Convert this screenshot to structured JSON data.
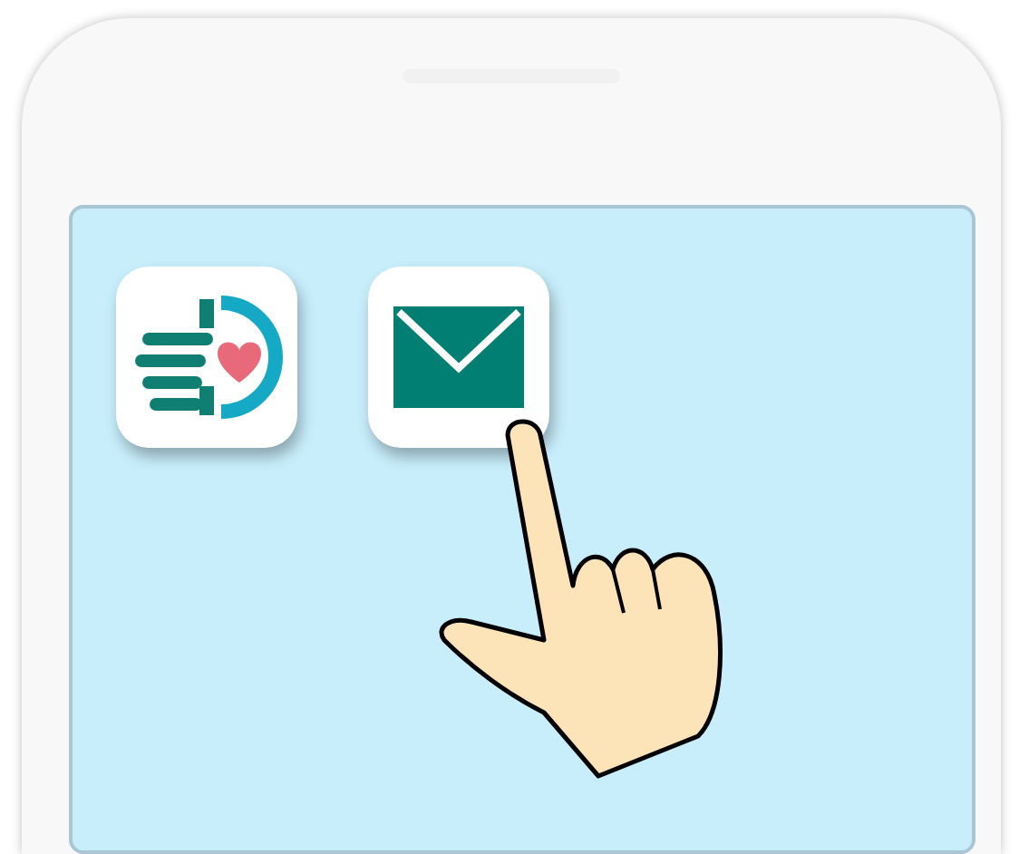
{
  "home_screen": {
    "apps": [
      {
        "kind": "care"
      },
      {
        "kind": "mail"
      }
    ]
  }
}
